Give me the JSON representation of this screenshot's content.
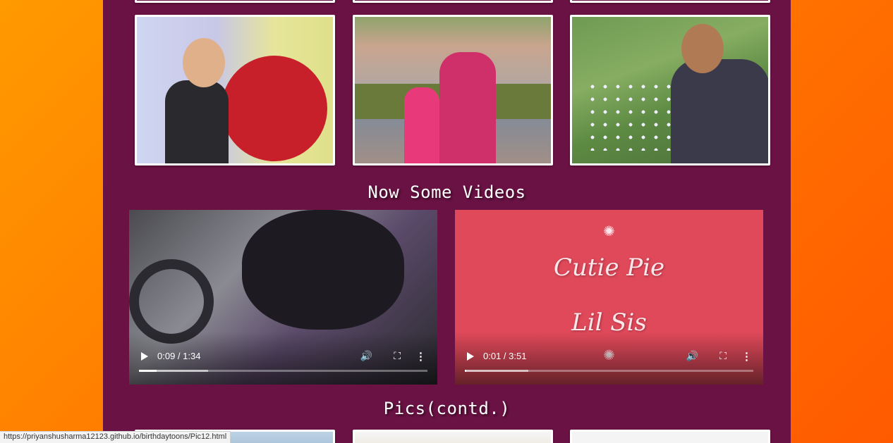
{
  "sections": {
    "videos_title": "Now Some Videos",
    "pics_contd_title": "Pics(contd.)"
  },
  "videos": [
    {
      "time": "0:09 / 1:34",
      "progress": 0.06,
      "buffered": 0.24
    },
    {
      "time": "0:01 / 3:51",
      "progress": 0.004,
      "buffered": 0.22,
      "overlay_line1": "Cutie Pie",
      "overlay_line2": "Lil Sis"
    }
  ],
  "status_bar": {
    "url": "https://priyanshusharma12123.github.io/birthdaytoons/Pic12.html"
  },
  "icons": {
    "play": "play-icon",
    "volume": "volume-icon",
    "fullscreen": "fullscreen-icon",
    "more": "more-options-icon"
  },
  "colors": {
    "background_gradient_start": "#ff9a00",
    "background_gradient_end": "#ff5a00",
    "panel": "#6b1244",
    "video2_bg": "#e0495a"
  }
}
